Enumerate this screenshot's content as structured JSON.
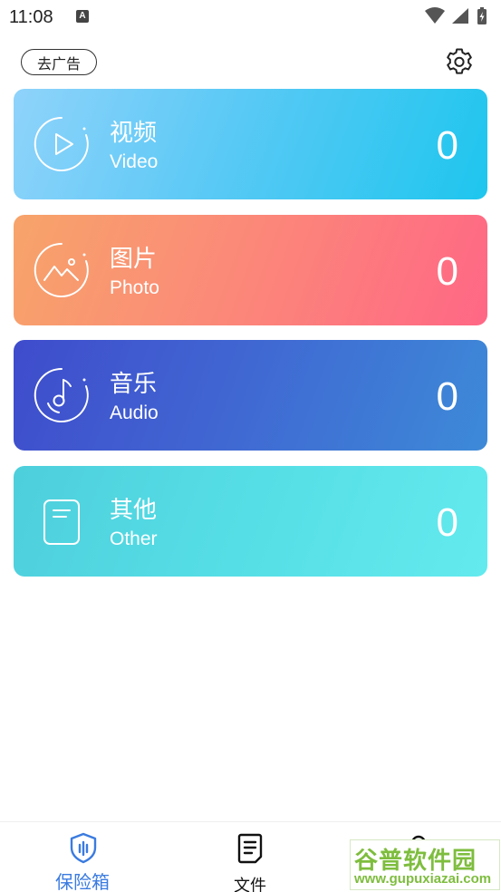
{
  "status_bar": {
    "time": "11:08",
    "notification_icon": "font-icon",
    "wifi_icon": "wifi-icon",
    "signal_icon": "signal-icon",
    "battery_icon": "battery-charging-icon"
  },
  "header": {
    "remove_ads_label": "去广告",
    "settings_icon": "gear-icon"
  },
  "categories": [
    {
      "title": "视频",
      "subtitle": "Video",
      "count": "0",
      "icon": "play-icon",
      "colors": [
        "#8fd3fb",
        "#1ec6ee"
      ]
    },
    {
      "title": "图片",
      "subtitle": "Photo",
      "count": "0",
      "icon": "image-icon",
      "colors": [
        "#f7a46a",
        "#ff6785"
      ]
    },
    {
      "title": "音乐",
      "subtitle": "Audio",
      "count": "0",
      "icon": "music-disc-icon",
      "colors": [
        "#3f4ccc",
        "#3d8ad8"
      ]
    },
    {
      "title": "其他",
      "subtitle": "Other",
      "count": "0",
      "icon": "document-icon",
      "colors": [
        "#4ecfdc",
        "#62eaee"
      ]
    }
  ],
  "tabbar": {
    "tabs": [
      {
        "label": "保险箱",
        "icon": "shield-icon",
        "active": true
      },
      {
        "label": "文件",
        "icon": "file-list-icon",
        "active": false
      },
      {
        "label": "",
        "icon": "user-icon",
        "active": false
      }
    ],
    "active_color": "#3a7be0"
  },
  "watermark": {
    "text": "谷普软件园",
    "url": "www.gupuxiazai.com"
  }
}
